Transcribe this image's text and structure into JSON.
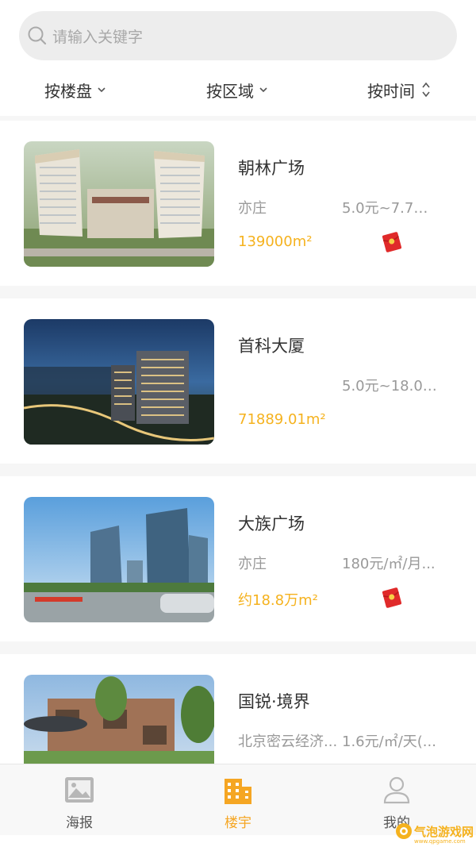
{
  "search": {
    "placeholder": "请输入关键字"
  },
  "filters": [
    {
      "label": "按楼盘"
    },
    {
      "label": "按区域"
    },
    {
      "label": "按时间"
    }
  ],
  "buildings": [
    {
      "name": "朝林广场",
      "area": "亦庄",
      "price": "5.0元~7.7元/...",
      "size": "139000m²",
      "has_red_packet": true
    },
    {
      "name": "首科大厦",
      "area": "",
      "price": "5.0元~18.0元...",
      "size": "71889.01m²",
      "has_red_packet": false
    },
    {
      "name": "大族广场",
      "area": "亦庄",
      "price": "180元/㎡/月...",
      "size": "约18.8万m²",
      "has_red_packet": true
    },
    {
      "name": "国锐·境界",
      "area": "北京密云经济...",
      "price": "1.6元/㎡/天(...",
      "size": "",
      "has_red_packet": false
    }
  ],
  "tabbar": {
    "items": [
      {
        "label": "海报",
        "icon": "image-icon",
        "active": false
      },
      {
        "label": "楼宇",
        "icon": "building-icon",
        "active": true
      },
      {
        "label": "我的",
        "icon": "user-icon",
        "active": false
      }
    ]
  },
  "watermark": {
    "text": "气泡游戏网",
    "sub": "www.qpgame.com"
  },
  "colors": {
    "accent": "#f5a623",
    "size_text": "#f5b21e",
    "red_packet": "#e02a2a"
  }
}
